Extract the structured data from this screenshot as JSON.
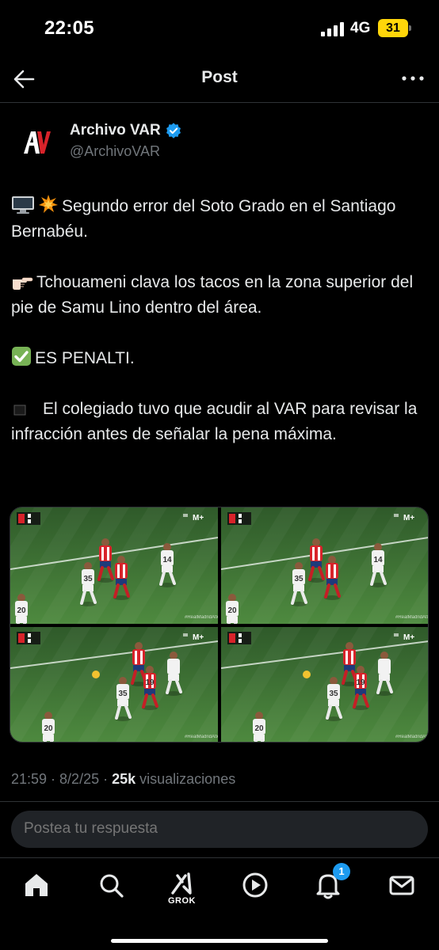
{
  "status_bar": {
    "time": "22:05",
    "network": "4G",
    "battery": "31"
  },
  "header": {
    "title": "Post"
  },
  "author": {
    "name": "Archivo VAR",
    "handle": "@ArchivoVAR"
  },
  "post": {
    "p1_icon": "desktop-computer-icon",
    "p1_text": "Segundo error del Soto Grado en el Santiago Bernabéu.",
    "p2_icon": "pointing-finger-icon",
    "p2_text": "Tchouameni clava los tacos en la zona superior del pie de Samu Lino dentro del área.",
    "p3_icon": "check-mark-icon",
    "p3_text": "ES PENALTI.",
    "p4_icon": "black-square-icon",
    "p4_text": "El colegiado tuvo que acudir al VAR para revisar la infracción antes de señalar la pena máxima."
  },
  "media": {
    "frame_count": 4,
    "frames": [
      {
        "shirt_a": "14",
        "shirt_b": "35",
        "shirt_c": "20"
      },
      {
        "shirt_a": "14",
        "shirt_b": "35",
        "shirt_c": "20"
      },
      {
        "shirt_a": "35",
        "shirt_b": "20",
        "shirt_c": "19"
      },
      {
        "shirt_a": "35",
        "shirt_b": "20",
        "shirt_c": "19"
      }
    ]
  },
  "meta": {
    "time": "21:59",
    "separator1": " · ",
    "date": "8/2/25",
    "separator2": " · ",
    "views_count": "25k",
    "views_label": " visualizaciones"
  },
  "reply": {
    "placeholder": "Postea tu respuesta"
  },
  "bottom_nav": {
    "tabs": [
      "home-icon",
      "search-icon",
      "grok-icon",
      "video-icon",
      "notifications-icon",
      "messages-icon"
    ],
    "grok_label": "GROK",
    "notification_badge": "1"
  },
  "colors": {
    "accent": "#1d9bf0",
    "battery": "#ffd60a",
    "pitch": "#3f7a35",
    "madrid_kit": "#f2f2f2",
    "atleti_red": "#d8232a"
  }
}
